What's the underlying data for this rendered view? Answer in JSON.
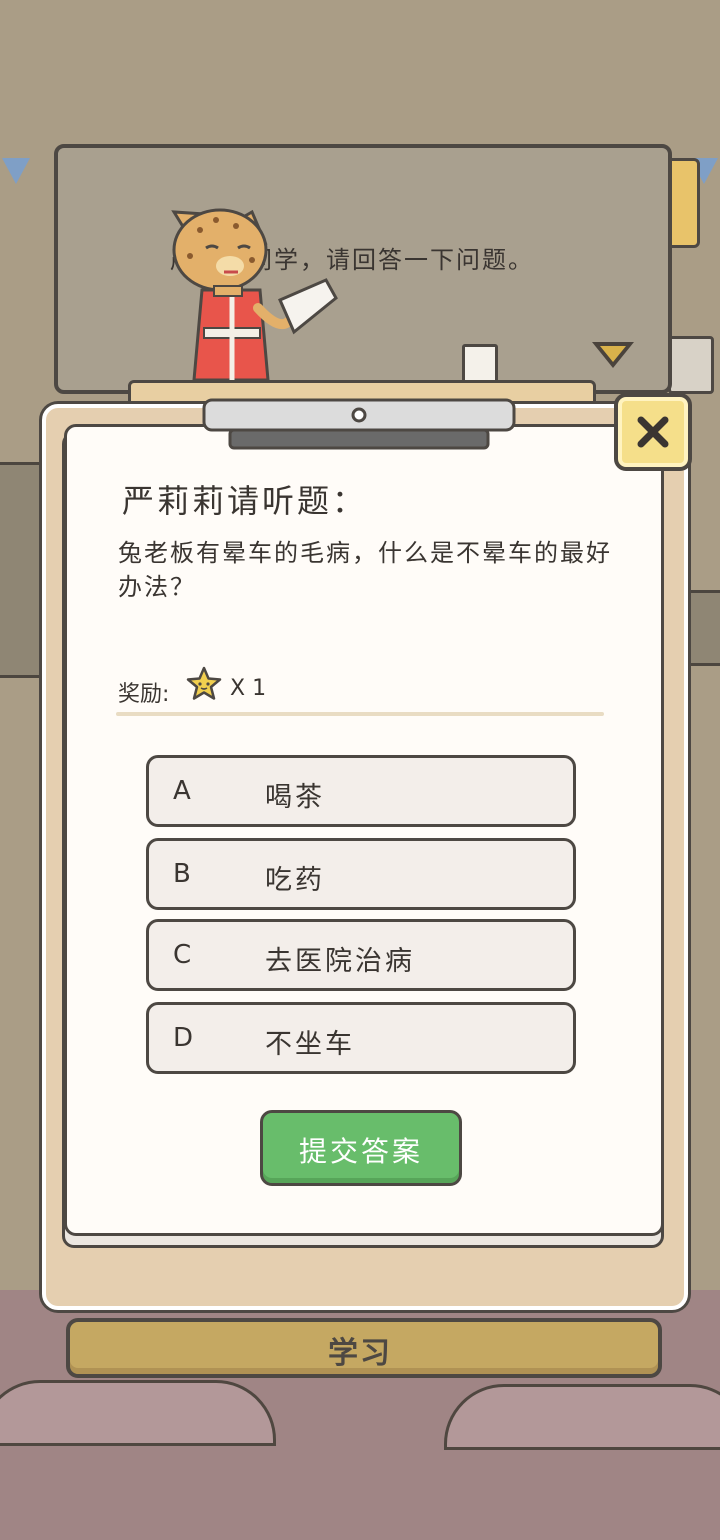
{
  "board": {
    "dialogue": "严莉莉同学，请回答一下问题。"
  },
  "quiz": {
    "title": "严莉莉请听题：",
    "question": "兔老板有晕车的毛病，什么是不晕车的最好办法？",
    "reward_label": "奖励:",
    "reward_quantity": "X 1",
    "options": [
      {
        "letter": "A",
        "text": "喝茶"
      },
      {
        "letter": "B",
        "text": "吃药"
      },
      {
        "letter": "C",
        "text": "去医院治病"
      },
      {
        "letter": "D",
        "text": "不坐车"
      }
    ],
    "submit_label": "提交答案"
  },
  "bottom_bar": {
    "label": "学习"
  },
  "icons": {
    "close": "close-icon",
    "reward": "star-icon",
    "next": "next-arrow-icon"
  },
  "colors": {
    "submit_green": "#68bd6b",
    "close_yellow": "#f5df8a",
    "paper": "#fffcf8",
    "study_bar": "#c5a862"
  }
}
